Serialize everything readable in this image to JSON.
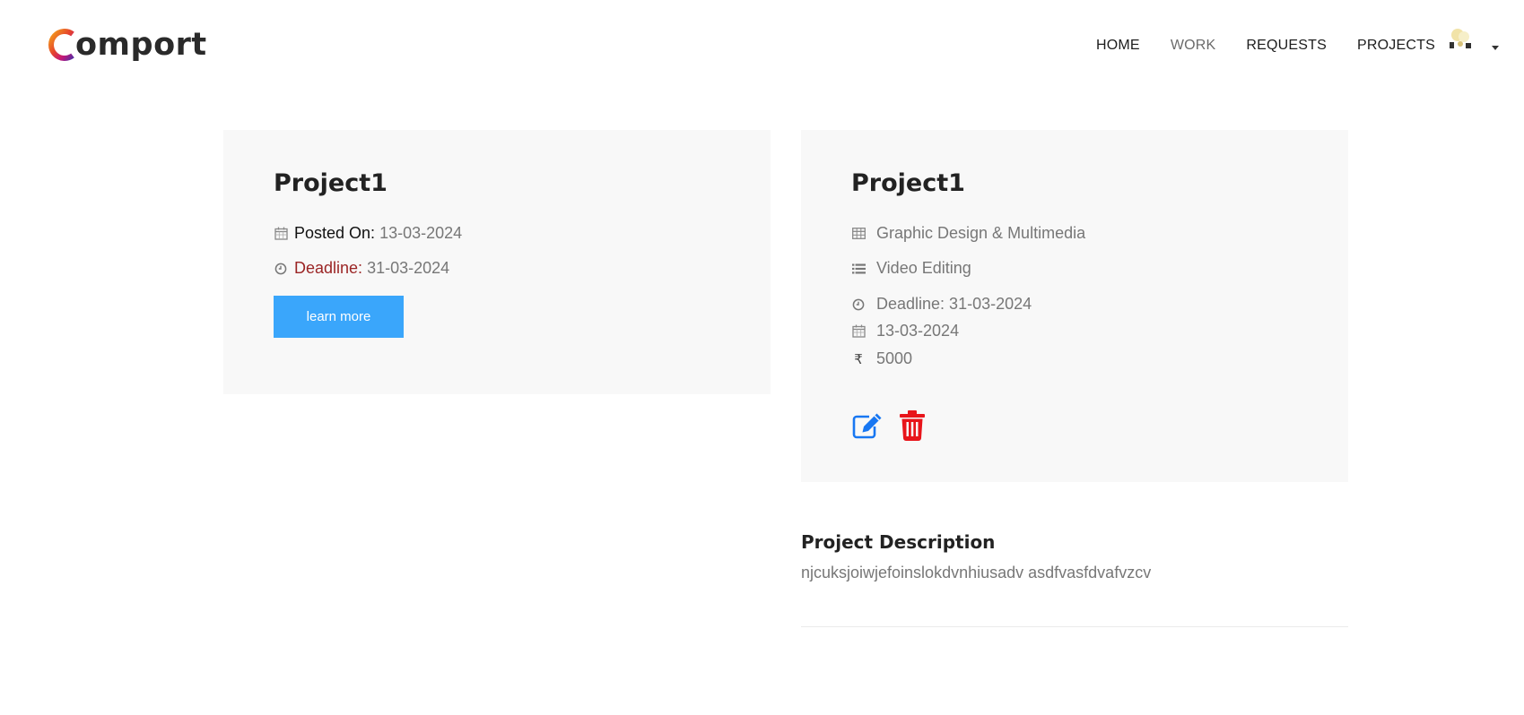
{
  "brand": {
    "logo_text": "omport",
    "logo_initial": "C"
  },
  "nav": {
    "items": [
      {
        "label": "HOME"
      },
      {
        "label": "WORK"
      },
      {
        "label": "REQUESTS"
      },
      {
        "label": "PROJECTS"
      }
    ],
    "active": "WORK"
  },
  "summary_card": {
    "title": "Project1",
    "posted_label": "Posted On:",
    "posted_value": "13-03-2024",
    "deadline_label": "Deadline:",
    "deadline_value": "31-03-2024",
    "button_label": "learn more"
  },
  "detail_card": {
    "title": "Project1",
    "category": "Graphic Design & Multimedia",
    "subcategory": "Video Editing",
    "deadline": "Deadline: 31-03-2024",
    "posted": "13-03-2024",
    "currency_symbol": "₹",
    "budget": "5000"
  },
  "description": {
    "title": "Project Description",
    "text": "njcuksjoiwjefoinslokdvnhiusadv asdfvasfdvafvzcv"
  },
  "colors": {
    "button": "#3aa6fb",
    "deadline_label": "#9b2525",
    "edit_icon": "#1877f2",
    "trash_icon": "#e8141a"
  }
}
